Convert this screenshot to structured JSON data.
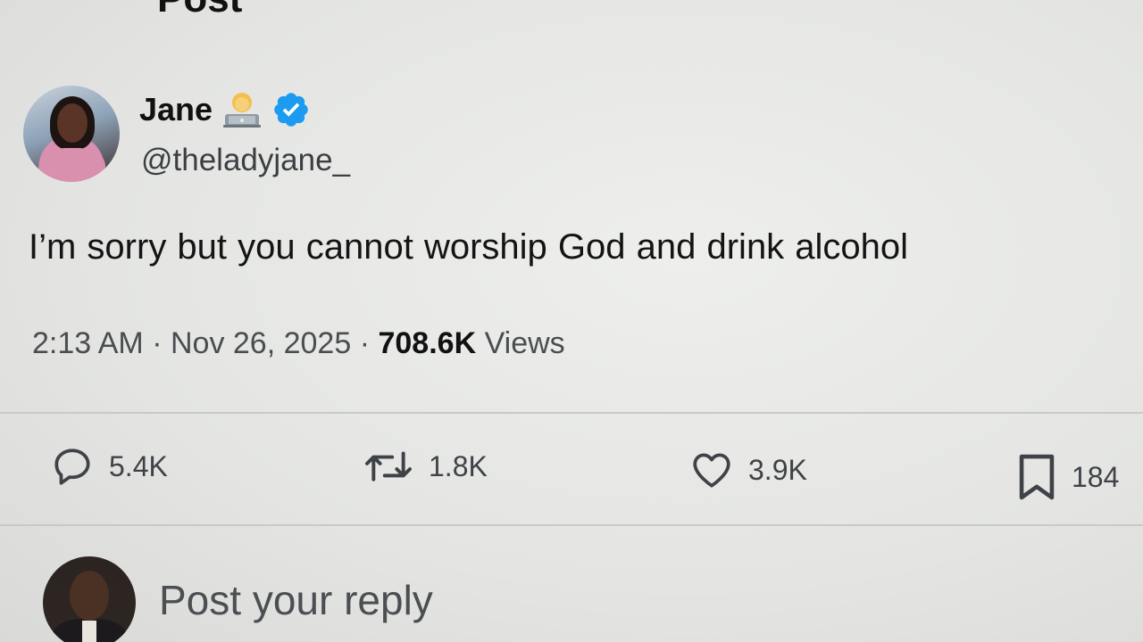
{
  "header": {
    "title": "Post"
  },
  "author": {
    "display_name": "Jane",
    "handle": "@theladyjane_",
    "emoji": "woman-technologist-emoji",
    "verified": true,
    "verified_color": "#1d9bf0"
  },
  "post": {
    "text": "I’m sorry but you cannot worship God and  drink alcohol",
    "time": "2:13 AM",
    "separator": "·",
    "date": "Nov 26, 2025",
    "views_count": "708.6K",
    "views_label": "Views"
  },
  "actions": {
    "replies": "5.4K",
    "reposts": "1.8K",
    "likes": "3.9K",
    "bookmarks": "184"
  },
  "reply": {
    "placeholder": "Post your reply"
  },
  "icons": {
    "reply": "reply-icon",
    "repost": "repost-icon",
    "like": "heart-icon",
    "bookmark": "bookmark-icon"
  }
}
